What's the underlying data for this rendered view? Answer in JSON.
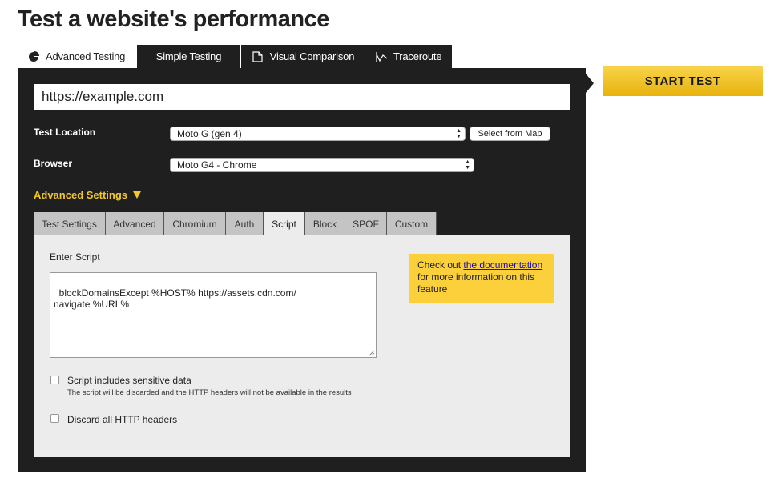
{
  "page": {
    "title": "Test a website's performance"
  },
  "tabs": [
    {
      "label": "Advanced Testing",
      "icon": "advanced-testing-icon",
      "active": true
    },
    {
      "label": "Simple Testing",
      "active": false
    },
    {
      "label": "Visual Comparison",
      "icon": "document-icon",
      "active": false
    },
    {
      "label": "Traceroute",
      "icon": "traceroute-icon",
      "active": false
    }
  ],
  "url_input": {
    "value": "https://example.com"
  },
  "start_button": {
    "label": "START TEST",
    "color": "#f2c62d"
  },
  "test_location": {
    "label": "Test Location",
    "selected": "Moto G (gen 4)",
    "map_button": "Select from Map"
  },
  "browser": {
    "label": "Browser",
    "selected": "Moto G4 - Chrome"
  },
  "advanced_settings": {
    "label": "Advanced Settings"
  },
  "subtabs": [
    {
      "label": "Test Settings",
      "active": false
    },
    {
      "label": "Advanced",
      "active": false
    },
    {
      "label": "Chromium",
      "active": false
    },
    {
      "label": "Auth",
      "active": false
    },
    {
      "label": "Script",
      "active": true
    },
    {
      "label": "Block",
      "active": false
    },
    {
      "label": "SPOF",
      "active": false
    },
    {
      "label": "Custom",
      "active": false
    }
  ],
  "script": {
    "label": "Enter Script",
    "value": "blockDomainsExcept %HOST% https://assets.cdn.com/\nnavigate %URL%"
  },
  "notice": {
    "prefix": "Check out ",
    "link": "the documentation",
    "suffix": "for more information on this feature"
  },
  "options": {
    "sensitive_label": "Script includes sensitive data",
    "sensitive_note": "The script will be discarded and the HTTP headers will not be available in the results",
    "discard_label": "Discard all HTTP headers"
  }
}
